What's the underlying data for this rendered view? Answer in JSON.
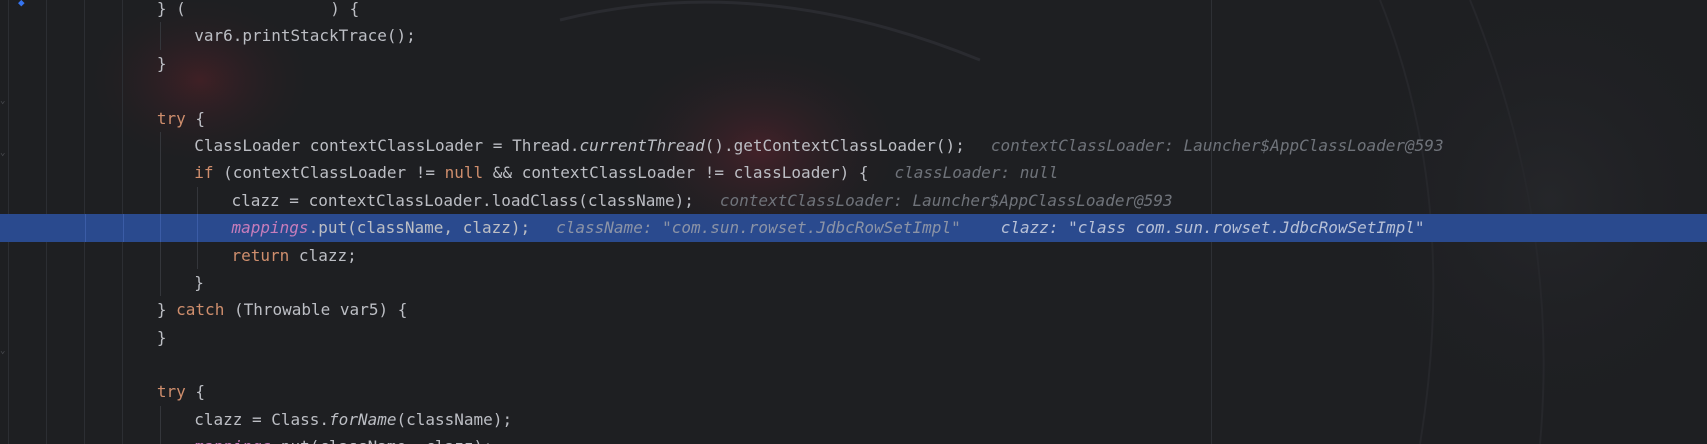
{
  "editor": {
    "lines": [
      {
        "id": "l0",
        "indent": 3,
        "tokens": [
          {
            "t": "} ",
            "c": ""
          },
          {
            "t": "(",
            "c": ""
          },
          {
            "t": "               ",
            "c": ""
          },
          {
            "t": ") {",
            "c": ""
          }
        ],
        "partial": true
      },
      {
        "id": "l1",
        "indent": 4,
        "tokens": [
          {
            "t": "var6.printStackTrace();",
            "c": ""
          }
        ]
      },
      {
        "id": "l2",
        "indent": 3,
        "tokens": [
          {
            "t": "}",
            "c": ""
          }
        ]
      },
      {
        "id": "l3",
        "indent": 0,
        "tokens": []
      },
      {
        "id": "l4",
        "indent": 3,
        "tokens": [
          {
            "t": "try",
            "c": "kw"
          },
          {
            "t": " {",
            "c": ""
          }
        ]
      },
      {
        "id": "l5",
        "indent": 4,
        "tokens": [
          {
            "t": "ClassLoader contextClassLoader = Thread.",
            "c": ""
          },
          {
            "t": "currentThread",
            "c": "static-m"
          },
          {
            "t": "().getContextClassLoader();",
            "c": ""
          }
        ],
        "hints": [
          "contextClassLoader: Launcher$AppClassLoader@593"
        ]
      },
      {
        "id": "l6",
        "indent": 4,
        "tokens": [
          {
            "t": "if",
            "c": "kw"
          },
          {
            "t": " (contextClassLoader != ",
            "c": ""
          },
          {
            "t": "null",
            "c": "kw"
          },
          {
            "t": " && contextClassLoader != classLoader) {",
            "c": ""
          }
        ],
        "hints": [
          "classLoader: null"
        ]
      },
      {
        "id": "l7",
        "indent": 5,
        "tokens": [
          {
            "t": "clazz = contextClassLoader.loadClass(className);",
            "c": ""
          }
        ],
        "hints": [
          "contextClassLoader: Launcher$AppClassLoader@593"
        ]
      },
      {
        "id": "l8",
        "indent": 5,
        "highlight": true,
        "tokens": [
          {
            "t": "mappings",
            "c": "field"
          },
          {
            "t": ".put(className, clazz);",
            "c": ""
          }
        ],
        "hints": [
          "className: \"com.sun.rowset.JdbcRowSetImpl\"",
          "clazz: \"class com.sun.rowset.JdbcRowSetImpl\""
        ]
      },
      {
        "id": "l9",
        "indent": 5,
        "tokens": [
          {
            "t": "return",
            "c": "kw"
          },
          {
            "t": " clazz;",
            "c": ""
          }
        ]
      },
      {
        "id": "l10",
        "indent": 4,
        "tokens": [
          {
            "t": "}",
            "c": ""
          }
        ]
      },
      {
        "id": "l11",
        "indent": 3,
        "tokens": [
          {
            "t": "} ",
            "c": ""
          },
          {
            "t": "catch",
            "c": "kw"
          },
          {
            "t": " (Throwable var5) {",
            "c": ""
          }
        ]
      },
      {
        "id": "l12",
        "indent": 3,
        "tokens": [
          {
            "t": "}",
            "c": ""
          }
        ]
      },
      {
        "id": "l13",
        "indent": 0,
        "tokens": []
      },
      {
        "id": "l14",
        "indent": 3,
        "tokens": [
          {
            "t": "try",
            "c": "kw"
          },
          {
            "t": " {",
            "c": ""
          }
        ]
      },
      {
        "id": "l15",
        "indent": 4,
        "tokens": [
          {
            "t": "clazz = Class.",
            "c": ""
          },
          {
            "t": "forName",
            "c": "static-m"
          },
          {
            "t": "(className);",
            "c": ""
          }
        ]
      },
      {
        "id": "l16",
        "indent": 4,
        "tokens": [
          {
            "t": "mappings",
            "c": "field"
          },
          {
            "t": ".put(className, clazz);",
            "c": ""
          }
        ]
      }
    ]
  },
  "colors": {
    "background": "#1e1f22",
    "highlight": "#2a4a8e",
    "keyword": "#cf8e6d",
    "field": "#c77dbb",
    "hint": "#6f737a",
    "text": "#bcbec4"
  },
  "icons": [
    "breakpoint-icon",
    "fold-marker-icon"
  ]
}
